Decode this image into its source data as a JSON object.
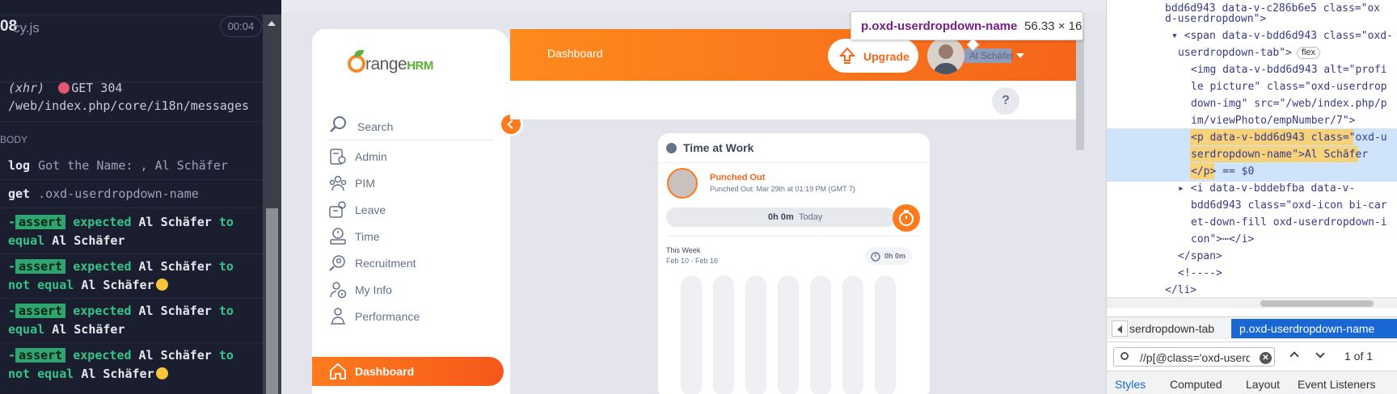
{
  "cypress": {
    "spec_num": "08",
    "spec_name": "cy.js",
    "timer": "00:04",
    "xhr": {
      "type": "(xhr)",
      "method_status": "GET 304",
      "url": "/web/index.php/core/i18n/messages"
    },
    "section_label": "BODY",
    "commands": [
      {
        "name": "log",
        "arg": "Got the Name: , Al Schäfer"
      },
      {
        "name": "get",
        "arg": ".oxd-userdropdown-name"
      }
    ],
    "assertions": [
      {
        "badge": "assert",
        "word1": "expected",
        "subject": "Al Schäfer",
        "word2": "to",
        "relation": "equal",
        "object": "Al Schäfer",
        "emoji": false
      },
      {
        "badge": "assert",
        "word1": "expected",
        "subject": "Al Schäfer",
        "word2": "to",
        "relation": "not equal",
        "object": "Al Schäfer",
        "emoji": true
      },
      {
        "badge": "assert",
        "word1": "expected",
        "subject": "Al Schäfer",
        "word2": "to",
        "relation": "equal",
        "object": "Al Schäfer",
        "emoji": false
      },
      {
        "badge": "assert",
        "word1": "expected",
        "subject": "Al Schäfer",
        "word2": "to",
        "relation": "not equal",
        "object": "Al Schäfer",
        "emoji": true
      }
    ]
  },
  "app": {
    "logo_text": "range",
    "logo_suffix": "HRM",
    "search_label": "Search",
    "nav_items": [
      {
        "label": "Admin",
        "icon": "admin-icon"
      },
      {
        "label": "PIM",
        "icon": "pim-icon"
      },
      {
        "label": "Leave",
        "icon": "leave-icon"
      },
      {
        "label": "Time",
        "icon": "time-icon"
      },
      {
        "label": "Recruitment",
        "icon": "recruitment-icon"
      },
      {
        "label": "My Info",
        "icon": "my-info-icon"
      },
      {
        "label": "Performance",
        "icon": "performance-icon"
      },
      {
        "label": "Dashboard",
        "icon": "dashboard-icon",
        "active": true
      }
    ],
    "header_title": "Dashboard",
    "upgrade_label": "Upgrade",
    "user_name": "Al Schäfer",
    "help_label": "?",
    "tooltip": {
      "selector": "p.oxd-userdropdown-name",
      "dims": "56.33 × 16"
    },
    "widget": {
      "title": "Time at Work",
      "punch_state": "Punched Out",
      "punch_time": "Punched Out: Mar 29th at 01:19 PM (GMT 7)",
      "today_value": "0h 0m",
      "today_label": "Today",
      "week_label": "This Week",
      "week_range": "Feb 10 - Feb 16",
      "week_total": "0h 0m"
    },
    "accent": "#ff7b1d"
  },
  "devtools": {
    "lines": [
      "bdd6d943 data-v-c286b6e5 class=\"ox",
      "d-userdropdown\">",
      "<span data-v-bdd6d943 class=\"oxd-",
      "userdropdown-tab\">",
      "<img data-v-bdd6d943 alt=\"profi",
      "le picture\" class=\"oxd-userdrop",
      "down-img\" src=\"/web/index.php/p",
      "im/viewPhoto/empNumber/7\">",
      "<p data-v-bdd6d943 class=\"oxd-u",
      "serdropdown-name\">Al Schäfer",
      "</p> == $0",
      "<i data-v-bddebfba data-v-",
      "bdd6d943 class=\"oxd-icon bi-car",
      "et-down-fill oxd-userdropdown-i",
      "con\">⋯</i>",
      "</span>",
      "<!---->",
      "</li>"
    ],
    "flex_badge": "flex",
    "breadcrumb_1": "serdropdown-tab",
    "breadcrumb_2": "p.oxd-userdropdown-name",
    "find_query": "//p[@class='oxd-userd",
    "find_count": "1 of 1",
    "tabs": [
      "Styles",
      "Computed",
      "Layout",
      "Event Listeners"
    ]
  }
}
